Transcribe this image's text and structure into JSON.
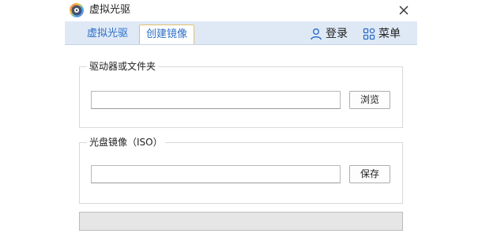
{
  "window": {
    "title": "虚拟光驱",
    "logo_icon": "disc-logo-icon",
    "close_icon": "close-icon"
  },
  "tabs": [
    {
      "label": "虚拟光驱",
      "active": false
    },
    {
      "label": "创建镜像",
      "active": true
    }
  ],
  "toolbar": {
    "login_label": "登录",
    "login_icon": "user-icon",
    "menu_label": "菜单",
    "menu_icon": "grid-menu-icon",
    "accent_color": "#2b6ec7"
  },
  "source_group": {
    "legend": "驱动器或文件夹",
    "path_value": "",
    "button_label": "浏览"
  },
  "iso_group": {
    "legend": "光盘镜像（ISO）",
    "path_value": "",
    "button_label": "保存"
  },
  "progress": {
    "value": 0
  }
}
